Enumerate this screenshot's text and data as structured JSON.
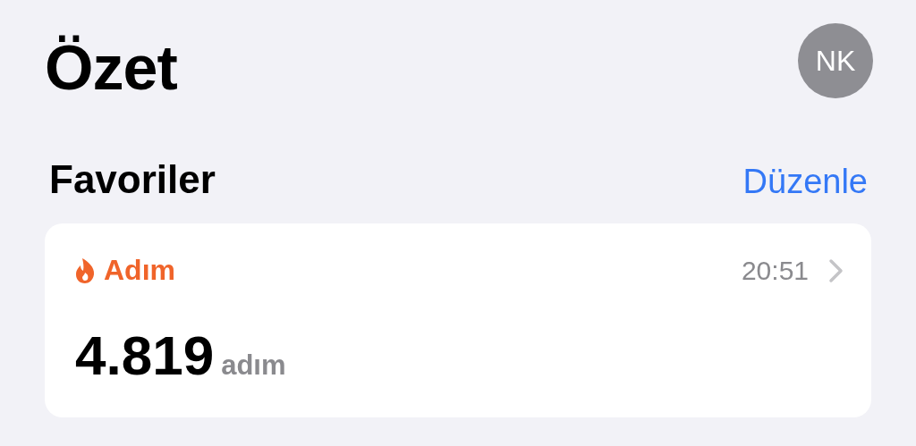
{
  "header": {
    "title": "Özet",
    "avatar_initials": "NK"
  },
  "favorites": {
    "title": "Favoriler",
    "edit_link": "Düzenle"
  },
  "cards": [
    {
      "metric": "Adım",
      "time": "20:51",
      "value": "4.819",
      "unit": "adım"
    }
  ]
}
